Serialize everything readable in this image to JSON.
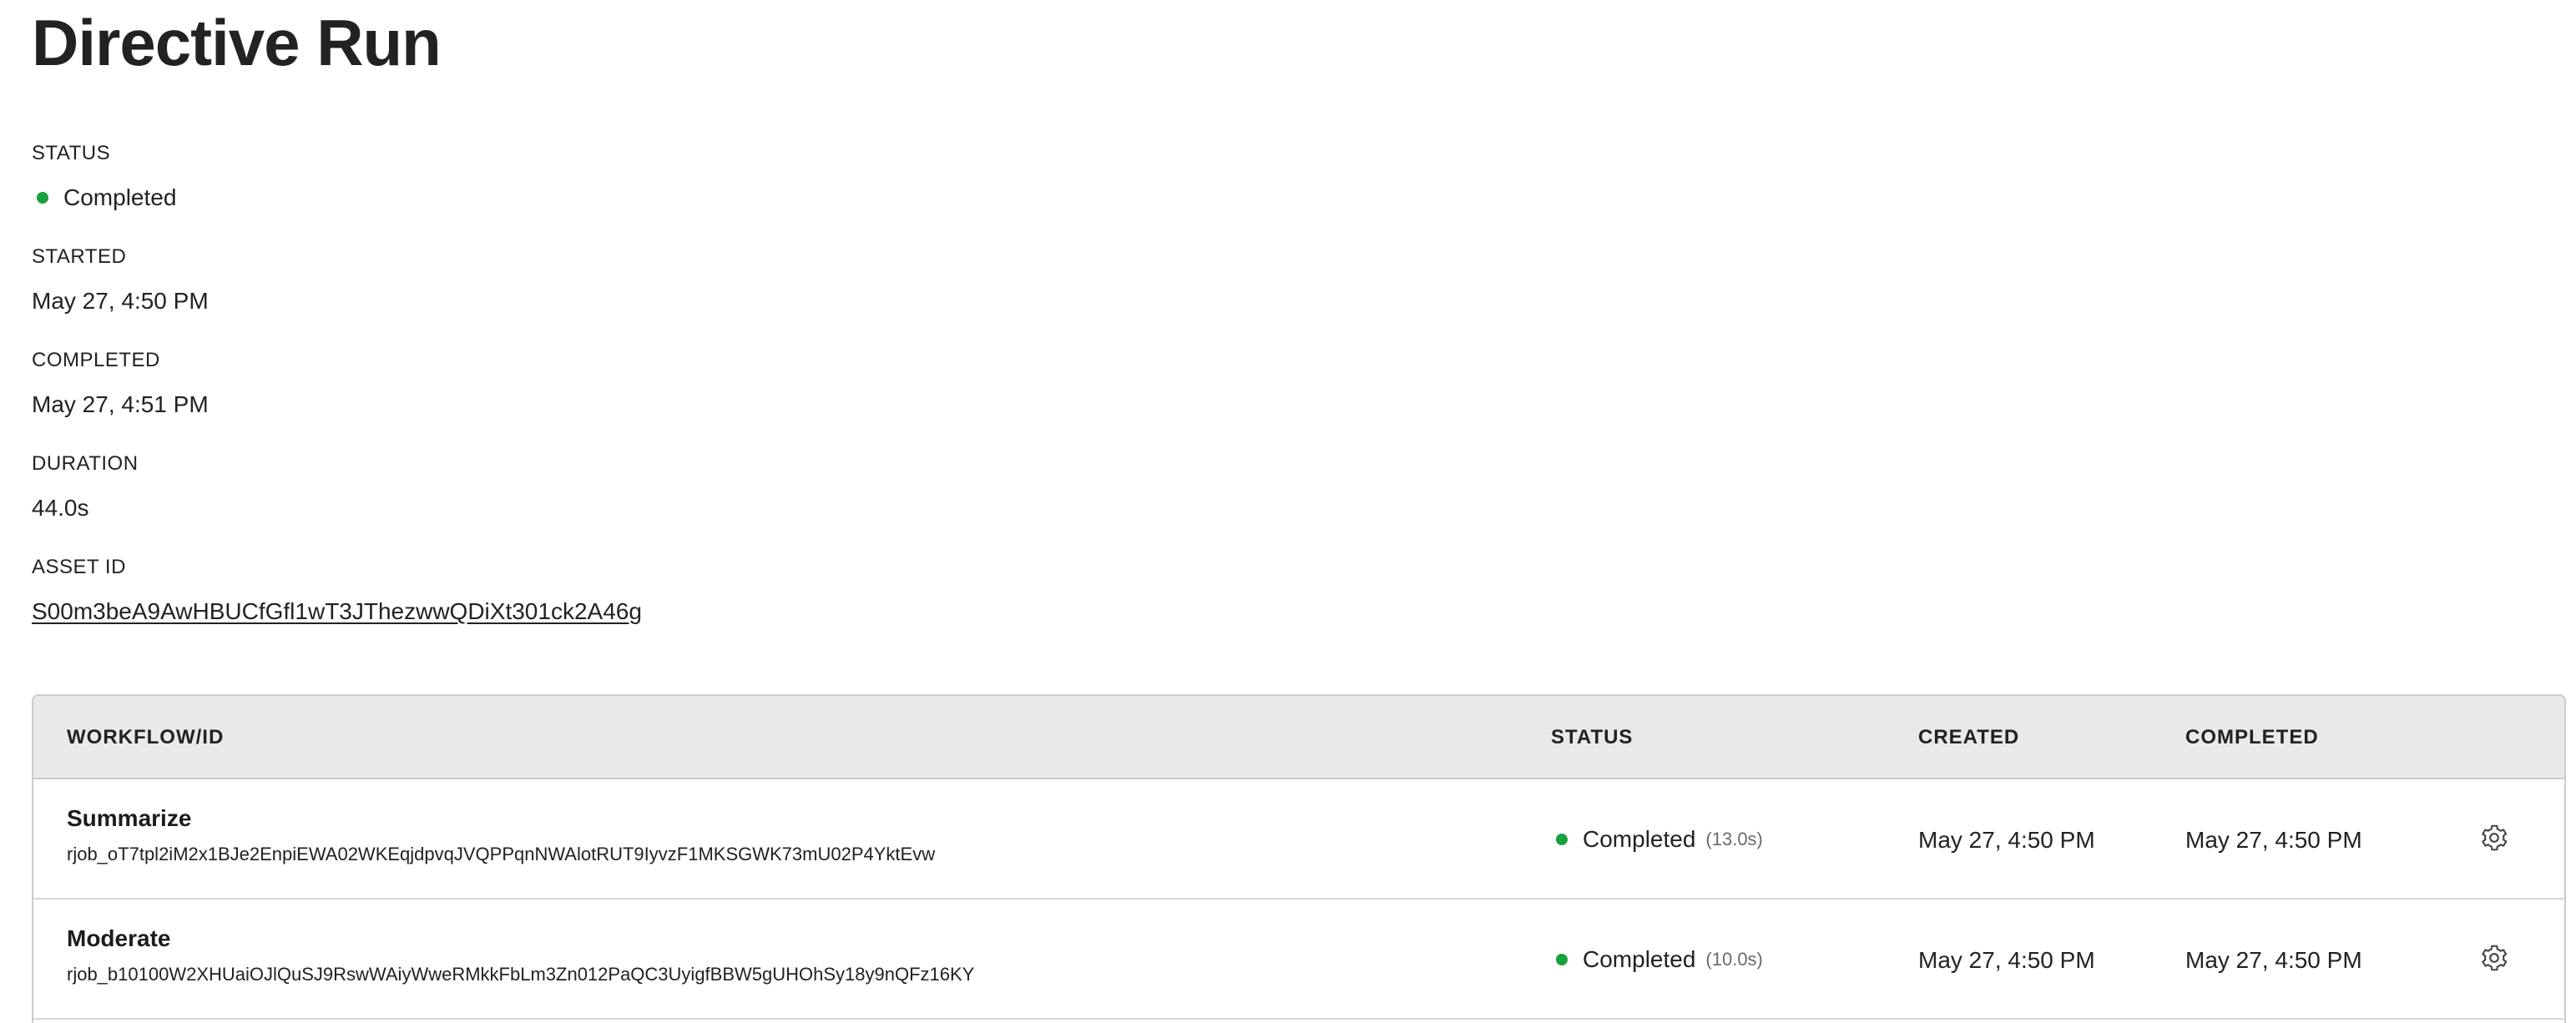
{
  "page": {
    "title": "Directive Run"
  },
  "fields": {
    "status": {
      "label": "STATUS",
      "value": "Completed"
    },
    "started": {
      "label": "STARTED",
      "value": "May 27, 4:50 PM"
    },
    "completed": {
      "label": "COMPLETED",
      "value": "May 27, 4:51 PM"
    },
    "duration": {
      "label": "DURATION",
      "value": "44.0s"
    },
    "asset_id": {
      "label": "ASSET ID",
      "value": "S00m3beA9AwHBUCfGfl1wT3JThezwwQDiXt301ck2A46g"
    }
  },
  "table": {
    "columns": {
      "workflow": "WORKFLOW/ID",
      "status": "STATUS",
      "created": "CREATED",
      "completed": "COMPLETED"
    },
    "rows": [
      {
        "name": "Summarize",
        "id": "rjob_oT7tpl2iM2x1BJe2EnpiEWA02WKEqjdpvqJVQPPqnNWAlotRUT9IyvzF1MKSGWK73mU02P4YktEvw",
        "status": "Completed",
        "duration": "(13.0s)",
        "created": "May 27, 4:50 PM",
        "completed": "May 27, 4:50 PM"
      },
      {
        "name": "Moderate",
        "id": "rjob_b10100W2XHUaiOJlQuSJ9RswWAiyWweRMkkFbLm3Zn012PaQC3UyigfBBW5gUHOhSy18y9nQFz16KY",
        "status": "Completed",
        "duration": "(10.0s)",
        "created": "May 27, 4:50 PM",
        "completed": "May 27, 4:50 PM"
      }
    ]
  },
  "colors": {
    "status_completed": "#18a13d",
    "header_bg": "#e8e9eb"
  },
  "icons": {
    "row_settings": "gear-icon",
    "status_indicator": "status-dot-icon"
  }
}
